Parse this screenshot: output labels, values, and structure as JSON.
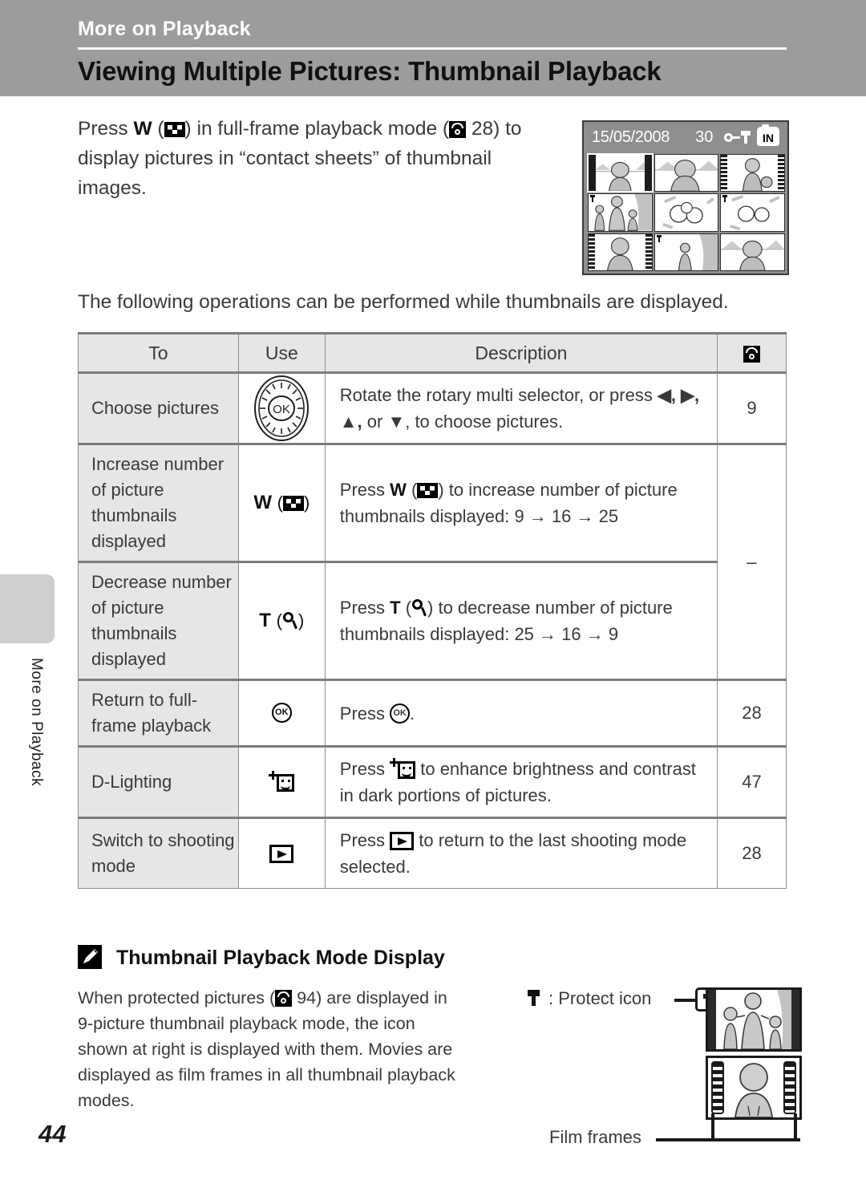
{
  "header": {
    "chapter": "More on Playback",
    "title": "Viewing Multiple Pictures: Thumbnail Playback"
  },
  "side_tab": {
    "label": "More on Playback"
  },
  "intro": {
    "part1": "Press ",
    "w": "W",
    "part2": " (",
    "part3": ") in full-frame playback mode (",
    "page_ref": "28",
    "part4": ") to display pictures in “contact sheets” of thumbnail images."
  },
  "lead": "The following operations can be performed while thumbnails are displayed.",
  "lcd": {
    "date": "15/05/2008",
    "count": "30",
    "memory": "IN"
  },
  "table": {
    "headers": {
      "to": "To",
      "use": "Use",
      "description": "Description",
      "reference_icon": "page-ref-icon"
    },
    "rows": [
      {
        "to": "Choose pictures",
        "use_icon": "rotary-multi-selector-dial",
        "use_label": "",
        "desc_pre": "Rotate the rotary multi selector, or press ",
        "desc_arrows": "◀, ▶, ▲,",
        "desc_post": " or ▼, to choose pictures.",
        "ref": "9"
      },
      {
        "to": "Increase number of picture thumbnails displayed",
        "use_icon": "w-thumbnail-button",
        "use_label": "W",
        "desc_pre": "Press ",
        "desc_bold": "W",
        "desc_post": ") to increase number of picture thumbnails displayed: 9 → 16 → 25",
        "ref": "–"
      },
      {
        "to": "Decrease number of picture thumbnails displayed",
        "use_icon": "t-magnifier-button",
        "use_label": "T",
        "desc_pre": "Press ",
        "desc_bold": "T",
        "desc_post": ") to decrease number of picture thumbnails displayed: 25 → 16 → 9",
        "ref": ""
      },
      {
        "to": "Return to full-frame playback",
        "use_icon": "ok-button",
        "use_label": "",
        "desc_pre": "Press ",
        "desc_post": ".",
        "ref": "28"
      },
      {
        "to": "D-Lighting",
        "use_icon": "d-lighting-button",
        "use_label": "",
        "desc_pre": "Press ",
        "desc_post": " to enhance brightness and contrast in dark portions of pictures.",
        "ref": "47"
      },
      {
        "to": "Switch to shooting mode",
        "use_icon": "playback-button",
        "use_label": "",
        "desc_pre": "Press ",
        "desc_post": " to return to the last shooting mode selected.",
        "ref": "28"
      }
    ]
  },
  "note": {
    "icon": "pencil-icon",
    "title": "Thumbnail Playback Mode Display",
    "body_pre": "When protected pictures (",
    "body_ref": "94",
    "body_post": ") are displayed in 9-picture thumbnail playback mode, the icon shown at right is displayed with them. Movies are displayed as film frames in all thumbnail playback modes."
  },
  "figure": {
    "protect_label": ": Protect icon",
    "film_label": "Film frames"
  },
  "page_number": "44",
  "colors": {
    "header_band": "#9c9c9c",
    "table_header_bg": "#e6e6e6",
    "rule": "#7c7c7c",
    "text": "#3a3a3a"
  }
}
